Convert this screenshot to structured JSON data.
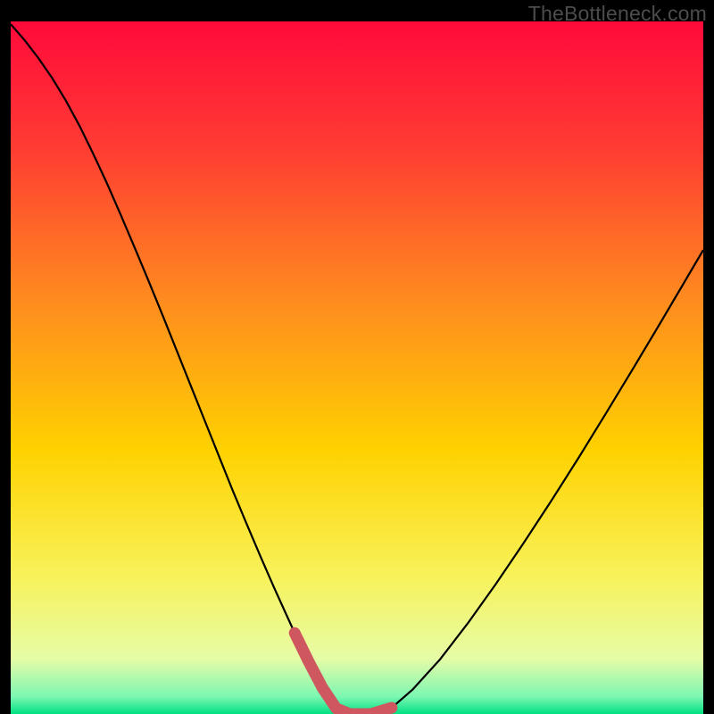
{
  "watermark": "TheBottleneck.com",
  "chart_data": {
    "type": "line",
    "title": "",
    "xlabel": "",
    "ylabel": "",
    "xlim": [
      0,
      100
    ],
    "ylim": [
      0,
      100
    ],
    "grid": false,
    "legend": false,
    "gradient_stops": [
      {
        "offset": 0.0,
        "color": "#ff0a3b"
      },
      {
        "offset": 0.18,
        "color": "#ff3b33"
      },
      {
        "offset": 0.4,
        "color": "#ff8a1f"
      },
      {
        "offset": 0.62,
        "color": "#ffd200"
      },
      {
        "offset": 0.8,
        "color": "#f8f25a"
      },
      {
        "offset": 0.92,
        "color": "#e6fca6"
      },
      {
        "offset": 0.975,
        "color": "#7cf7b2"
      },
      {
        "offset": 1.0,
        "color": "#00e082"
      }
    ],
    "series": [
      {
        "name": "bottleneck-curve",
        "color": "#000000",
        "width": 2.2,
        "x": [
          0,
          2,
          4,
          6,
          8,
          10,
          12,
          14,
          16,
          18,
          20,
          22,
          24,
          26,
          28,
          30,
          32,
          34,
          36,
          38,
          40,
          41,
          43,
          45,
          47,
          49,
          52,
          55,
          58,
          62,
          66,
          70,
          74,
          78,
          82,
          86,
          90,
          94,
          98,
          100
        ],
        "y": [
          99.6,
          97.3,
          94.7,
          91.8,
          88.5,
          84.8,
          80.7,
          76.4,
          71.8,
          67.1,
          62.3,
          57.4,
          52.4,
          47.4,
          42.4,
          37.4,
          32.4,
          27.6,
          22.9,
          18.3,
          13.9,
          11.7,
          7.6,
          3.8,
          0.8,
          0.0,
          0.0,
          0.9,
          3.5,
          7.9,
          13.1,
          18.7,
          24.6,
          30.7,
          37.0,
          43.5,
          50.1,
          56.8,
          63.6,
          67.0
        ]
      },
      {
        "name": "optimal-band",
        "color": "#cf575f",
        "width": 13,
        "linecap": "round",
        "x": [
          41,
          43,
          45,
          47,
          49,
          52,
          55
        ],
        "y": [
          11.7,
          7.6,
          3.8,
          0.8,
          0.0,
          0.0,
          0.9
        ]
      }
    ]
  }
}
